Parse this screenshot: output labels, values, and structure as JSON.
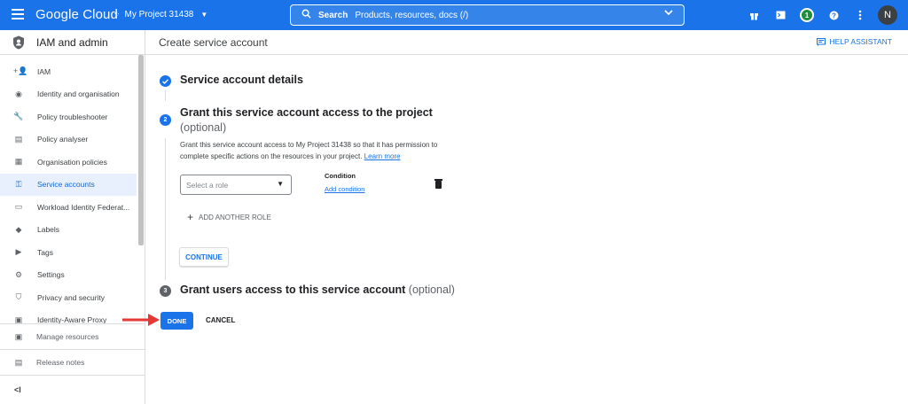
{
  "topbar": {
    "logo": "Google Cloud",
    "project": "My Project 31438",
    "search_label": "Search",
    "search_placeholder": "Products, resources, docs (/)",
    "notification_count": "1",
    "avatar_initial": "N"
  },
  "sidebar": {
    "title": "IAM and admin",
    "items": [
      {
        "label": "IAM",
        "icon": "person-add-icon"
      },
      {
        "label": "Identity and organisation",
        "icon": "account-circle-icon"
      },
      {
        "label": "Policy troubleshooter",
        "icon": "wrench-icon"
      },
      {
        "label": "Policy analyser",
        "icon": "document-search-icon"
      },
      {
        "label": "Organisation policies",
        "icon": "list-document-icon"
      },
      {
        "label": "Service accounts",
        "icon": "service-account-icon",
        "active": true
      },
      {
        "label": "Workload Identity Federat...",
        "icon": "id-card-icon"
      },
      {
        "label": "Labels",
        "icon": "label-icon"
      },
      {
        "label": "Tags",
        "icon": "tag-icon"
      },
      {
        "label": "Settings",
        "icon": "gear-icon"
      },
      {
        "label": "Privacy and security",
        "icon": "shield-icon"
      },
      {
        "label": "Identity-Aware Proxy",
        "icon": "proxy-icon"
      }
    ],
    "bottom": [
      {
        "label": "Manage resources",
        "icon": "folder-gear-icon"
      },
      {
        "label": "Release notes",
        "icon": "release-notes-icon"
      }
    ],
    "collapse_label": "<I"
  },
  "main": {
    "page_title": "Create service account",
    "help_label": "HELP ASSISTANT",
    "step1": {
      "title": "Service account details"
    },
    "step2": {
      "number": "2",
      "title": "Grant this service account access to the project",
      "optional": "(optional)",
      "description": "Grant this service account access to My Project 31438 so that it has permission to complete specific actions on the resources in your project.",
      "learn_more": "Learn more",
      "role_placeholder": "Select a role",
      "condition_label": "Condition",
      "add_condition": "Add condition",
      "add_another_role": "ADD ANOTHER ROLE",
      "continue": "CONTINUE"
    },
    "step3": {
      "number": "3",
      "title": "Grant users access to this service account",
      "optional": "(optional)"
    },
    "done": "DONE",
    "cancel": "CANCEL"
  },
  "colors": {
    "accent": "#1a73e8",
    "arrow": "#e53935",
    "active_bg": "#e8f0fe"
  }
}
